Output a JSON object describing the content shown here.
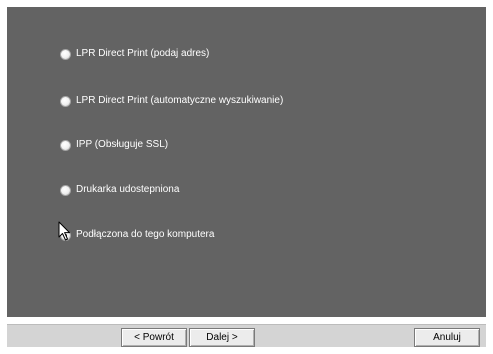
{
  "options": [
    {
      "label": "LPR Direct Print (podaj adres)",
      "checked": false
    },
    {
      "label": "LPR Direct Print (automatyczne wyszukiwanie)",
      "checked": false
    },
    {
      "label": "IPP (Obsługuje SSL)",
      "checked": false
    },
    {
      "label": "Drukarka udostepniona",
      "checked": false
    },
    {
      "label": "Podłączona do tego komputera",
      "checked": true
    }
  ],
  "buttons": {
    "back_label": "< Powrót",
    "next_label": "Dalej >",
    "cancel_label": "Anuluj"
  },
  "colors": {
    "panel": "#636363",
    "bottom_bar": "#d4d4d4"
  },
  "icons": {
    "cursor": "mouse-pointer-icon"
  }
}
